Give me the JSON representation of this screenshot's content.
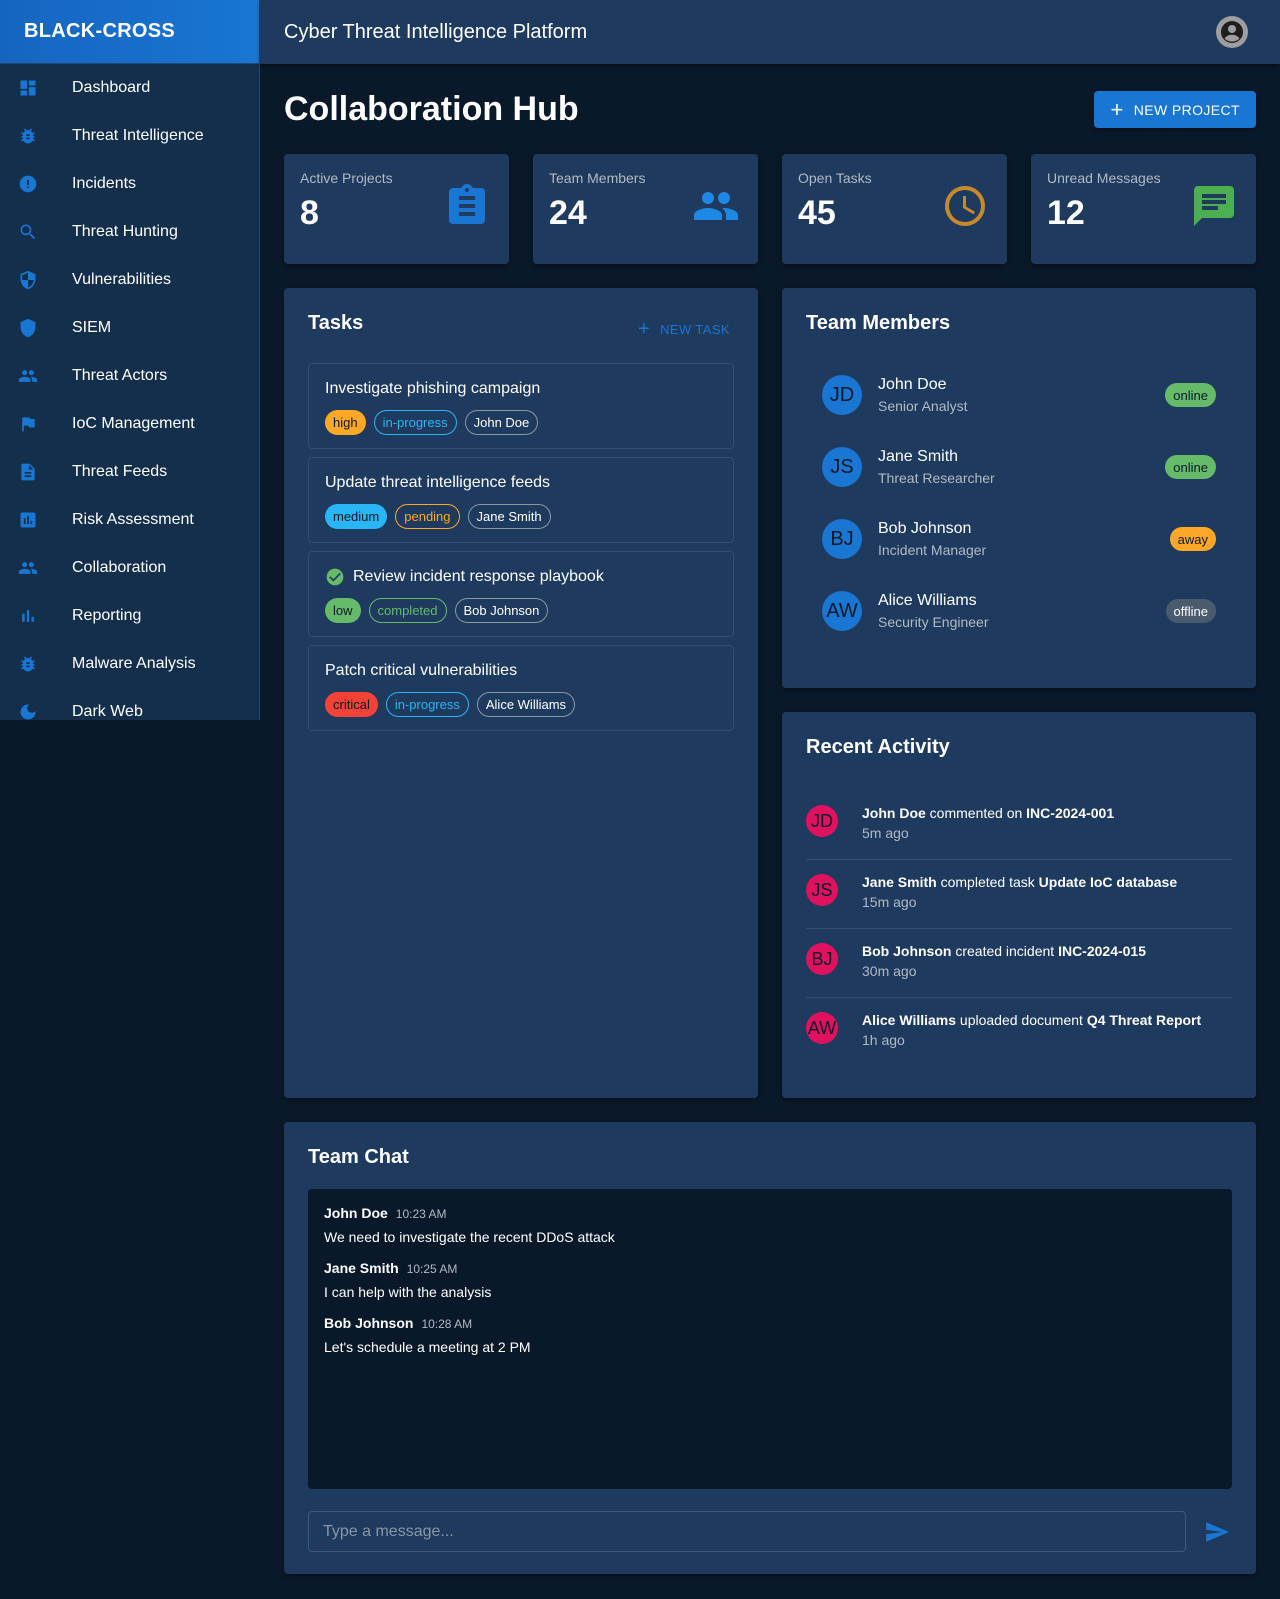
{
  "app": {
    "brand": "BLACK-CROSS",
    "header_title": "Cyber Threat Intelligence Platform"
  },
  "sidebar": {
    "items": [
      {
        "label": "Dashboard",
        "icon": "dashboard-icon"
      },
      {
        "label": "Threat Intelligence",
        "icon": "bug-icon"
      },
      {
        "label": "Incidents",
        "icon": "alert-icon"
      },
      {
        "label": "Threat Hunting",
        "icon": "search-icon"
      },
      {
        "label": "Vulnerabilities",
        "icon": "shield-half-icon"
      },
      {
        "label": "SIEM",
        "icon": "shield-icon"
      },
      {
        "label": "Threat Actors",
        "icon": "people-icon"
      },
      {
        "label": "IoC Management",
        "icon": "flag-icon"
      },
      {
        "label": "Threat Feeds",
        "icon": "document-icon"
      },
      {
        "label": "Risk Assessment",
        "icon": "assessment-icon"
      },
      {
        "label": "Collaboration",
        "icon": "people-icon"
      },
      {
        "label": "Reporting",
        "icon": "bar-chart-icon"
      },
      {
        "label": "Malware Analysis",
        "icon": "bug-icon"
      },
      {
        "label": "Dark Web",
        "icon": "moon-icon"
      }
    ]
  },
  "page": {
    "title": "Collaboration Hub",
    "new_project_label": "NEW PROJECT"
  },
  "stats": [
    {
      "label": "Active Projects",
      "value": "8",
      "icon": "clipboard-icon",
      "color": "#1976d2"
    },
    {
      "label": "Team Members",
      "value": "24",
      "icon": "group-icon",
      "color": "#1e88e5"
    },
    {
      "label": "Open Tasks",
      "value": "45",
      "icon": "clock-icon",
      "color": "#c7892a"
    },
    {
      "label": "Unread Messages",
      "value": "12",
      "icon": "message-icon",
      "color": "#4caf50"
    }
  ],
  "tasks": {
    "title": "Tasks",
    "new_task_label": "NEW TASK",
    "items": [
      {
        "title": "Investigate phishing campaign",
        "priority": "high",
        "status": "in-progress",
        "assignee": "John Doe",
        "completed": false
      },
      {
        "title": "Update threat intelligence feeds",
        "priority": "medium",
        "status": "pending",
        "assignee": "Jane Smith",
        "completed": false
      },
      {
        "title": "Review incident response playbook",
        "priority": "low",
        "status": "completed",
        "assignee": "Bob Johnson",
        "completed": true
      },
      {
        "title": "Patch critical vulnerabilities",
        "priority": "critical",
        "status": "in-progress",
        "assignee": "Alice Williams",
        "completed": false
      }
    ]
  },
  "team": {
    "title": "Team Members",
    "members": [
      {
        "initials": "JD",
        "name": "John Doe",
        "role": "Senior Analyst",
        "status": "online"
      },
      {
        "initials": "JS",
        "name": "Jane Smith",
        "role": "Threat Researcher",
        "status": "online"
      },
      {
        "initials": "BJ",
        "name": "Bob Johnson",
        "role": "Incident Manager",
        "status": "away"
      },
      {
        "initials": "AW",
        "name": "Alice Williams",
        "role": "Security Engineer",
        "status": "offline"
      }
    ]
  },
  "activity": {
    "title": "Recent Activity",
    "items": [
      {
        "initials": "JD",
        "user": "John Doe",
        "action": "commented on",
        "target": "INC-2024-001",
        "time": "5m ago"
      },
      {
        "initials": "JS",
        "user": "Jane Smith",
        "action": "completed task",
        "target": "Update IoC database",
        "time": "15m ago"
      },
      {
        "initials": "BJ",
        "user": "Bob Johnson",
        "action": "created incident",
        "target": "INC-2024-015",
        "time": "30m ago"
      },
      {
        "initials": "AW",
        "user": "Alice Williams",
        "action": "uploaded document",
        "target": "Q4 Threat Report",
        "time": "1h ago"
      }
    ]
  },
  "chat": {
    "title": "Team Chat",
    "messages": [
      {
        "user": "John Doe",
        "time": "10:23 AM",
        "text": "We need to investigate the recent DDoS attack"
      },
      {
        "user": "Jane Smith",
        "time": "10:25 AM",
        "text": "I can help with the analysis"
      },
      {
        "user": "Bob Johnson",
        "time": "10:28 AM",
        "text": "Let's schedule a meeting at 2 PM"
      }
    ],
    "input_placeholder": "Type a message...",
    "input_value": ""
  },
  "colors": {
    "accent": "#1976d2",
    "background": "#0a1929",
    "surface": "#1e3a5f",
    "sidebar": "#132f4c",
    "high": "#ffa726",
    "medium": "#29b6f6",
    "low": "#66bb6a",
    "critical": "#f44336",
    "online": "#66bb6a",
    "away": "#ffa726",
    "offline": "#4a5b6e",
    "activity_avatar": "#e0115f"
  }
}
